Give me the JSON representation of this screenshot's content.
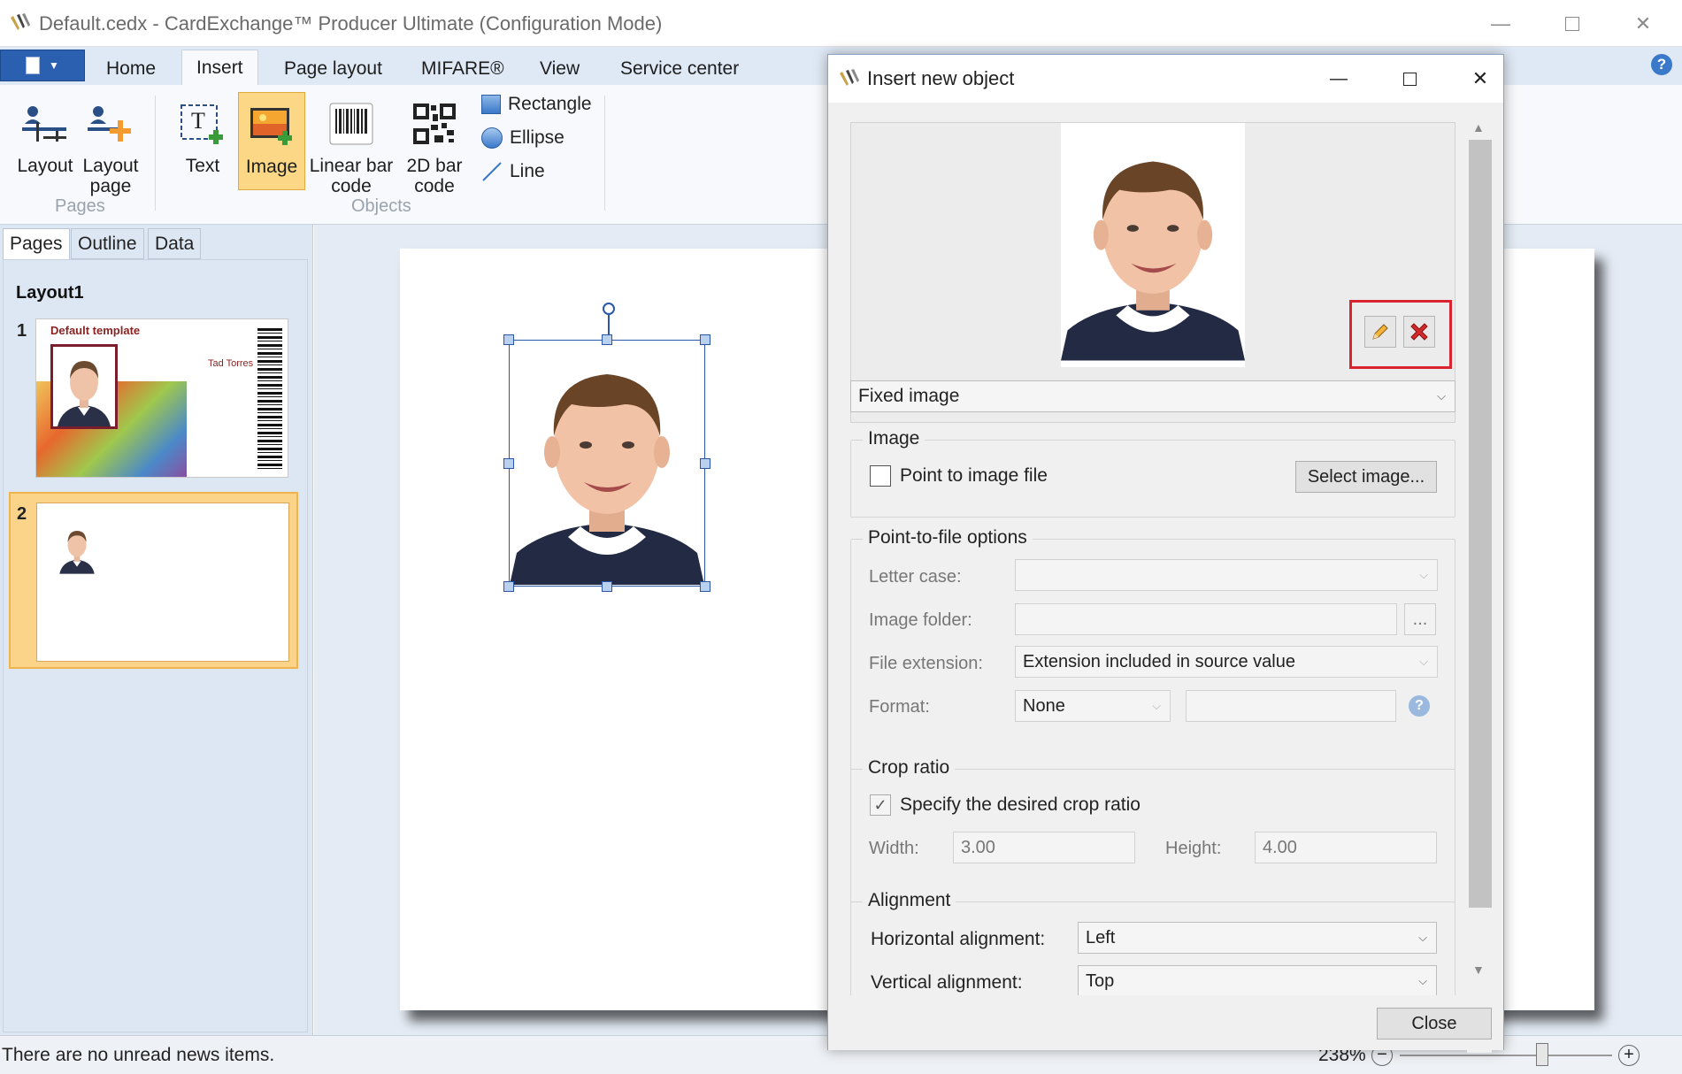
{
  "window": {
    "title": "Default.cedx - CardExchange™ Producer Ultimate (Configuration Mode)"
  },
  "ribbon_tabs": [
    "Home",
    "Insert",
    "Page layout",
    "MIFARE®",
    "View",
    "Service center"
  ],
  "ribbon": {
    "pages_group": {
      "label": "Pages",
      "layout": "Layout",
      "layout_page_1": "Layout",
      "layout_page_2": "page"
    },
    "objects_group": {
      "label": "Objects",
      "text": "Text",
      "image": "Image",
      "linear_1": "Linear bar",
      "linear_2": "code",
      "bar2d_1": "2D bar",
      "bar2d_2": "code",
      "rectangle": "Rectangle",
      "ellipse": "Ellipse",
      "line": "Line"
    }
  },
  "panel": {
    "tabs": [
      "Pages",
      "Outline",
      "Data"
    ],
    "layout_name": "Layout1",
    "pages": [
      {
        "number": "1",
        "template_title": "Default template",
        "card_name": "Tad Torres"
      },
      {
        "number": "2"
      }
    ]
  },
  "status": {
    "news": "There are no unread news items.",
    "zoom": "238%"
  },
  "dialog": {
    "title": "Insert new object",
    "source_type": "Fixed image",
    "image_group": {
      "label": "Image",
      "point_to_file": "Point to image file",
      "point_to_file_checked": false,
      "select_button": "Select image..."
    },
    "point_to_file_options": {
      "label": "Point-to-file options",
      "letter_case_label": "Letter case:",
      "letter_case_value": "",
      "image_folder_label": "Image folder:",
      "image_folder_value": "",
      "browse": "...",
      "file_extension_label": "File extension:",
      "file_extension_value": "Extension included in source value",
      "format_label": "Format:",
      "format_value": "None",
      "format_text": "",
      "help": "?"
    },
    "crop_ratio": {
      "label": "Crop ratio",
      "specify": "Specify the desired crop ratio",
      "specify_checked": true,
      "width_label": "Width:",
      "width_value": "3.00",
      "height_label": "Height:",
      "height_value": "4.00"
    },
    "alignment": {
      "label": "Alignment",
      "horizontal_label": "Horizontal alignment:",
      "horizontal_value": "Left",
      "vertical_label": "Vertical alignment:",
      "vertical_value": "Top"
    },
    "close_button": "Close"
  },
  "colors": {
    "accent": "#2b5fb0",
    "highlight_red": "#d9232e",
    "selected_orange": "#f7c86a"
  }
}
